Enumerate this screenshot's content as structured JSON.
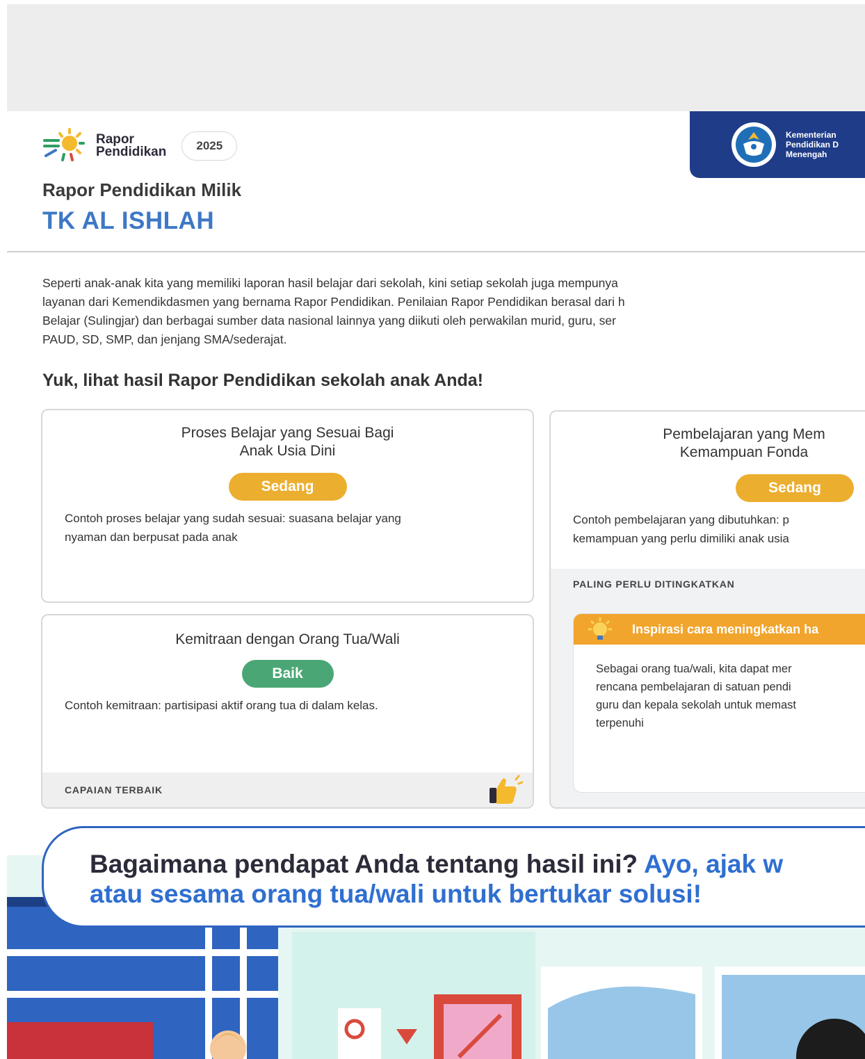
{
  "header": {
    "brand_line1": "Rapor",
    "brand_line2": "Pendidikan",
    "year": "2025",
    "ministry_text": "Kementerian\nPendidikan D\nMenengah"
  },
  "owner": {
    "label": "Rapor Pendidikan Milik",
    "school_name": "TK AL ISHLAH"
  },
  "intro": {
    "lines": [
      "Seperti anak-anak kita yang memiliki laporan hasil belajar dari sekolah, kini setiap sekolah juga mempunya",
      "layanan dari Kemendikdasmen yang bernama Rapor Pendidikan. Penilaian Rapor Pendidikan berasal dari h",
      "Belajar (Sulingjar) dan berbagai sumber data nasional lainnya yang diikuti oleh perwakilan murid, guru, ser",
      "PAUD, SD, SMP, dan jenjang SMA/sederajat."
    ]
  },
  "cta_heading": "Yuk, lihat hasil Rapor Pendidikan sekolah anak Anda!",
  "cards": {
    "proses": {
      "title_line1": "Proses Belajar yang Sesuai Bagi",
      "title_line2": "Anak Usia Dini",
      "status": "Sedang",
      "desc_line1": "Contoh proses belajar yang sudah sesuai: suasana belajar yang",
      "desc_line2": "nyaman dan berpusat pada anak"
    },
    "kemitraan": {
      "title": "Kemitraan dengan Orang Tua/Wali",
      "status": "Baik",
      "desc": "Contoh kemitraan: partisipasi aktif orang tua di dalam kelas.",
      "footer": "CAPAIAN TERBAIK"
    },
    "pembelajaran": {
      "title_line1": "Pembelajaran yang Mem",
      "title_line2": "Kemampuan Fonda",
      "status": "Sedang",
      "desc_line1": "Contoh pembelajaran yang dibutuhkan: p",
      "desc_line2": "kemampuan yang perlu dimiliki anak usia",
      "priority_label": "PALING PERLU DITINGKATKAN",
      "inspiration_header": "Inspirasi cara meningkatkan ha",
      "inspiration_lines": [
        "Sebagai orang tua/wali, kita dapat mer",
        "rencana pembelajaran di satuan pendi",
        "guru dan kepala sekolah untuk memast",
        "terpenuhi"
      ]
    }
  },
  "banner": {
    "line1_dark": "Bagaimana pendapat Anda tentang hasil ini? ",
    "line1_blue": "Ayo, ajak w",
    "line2_blue": "atau sesama orang tua/wali untuk bertukar solusi!"
  },
  "colors": {
    "school_name": "#3e78c6",
    "status_medium": "#ecae2f",
    "status_good": "#4aa775",
    "ministry_bg": "#1f3c88",
    "banner_border": "#2f64c0"
  }
}
